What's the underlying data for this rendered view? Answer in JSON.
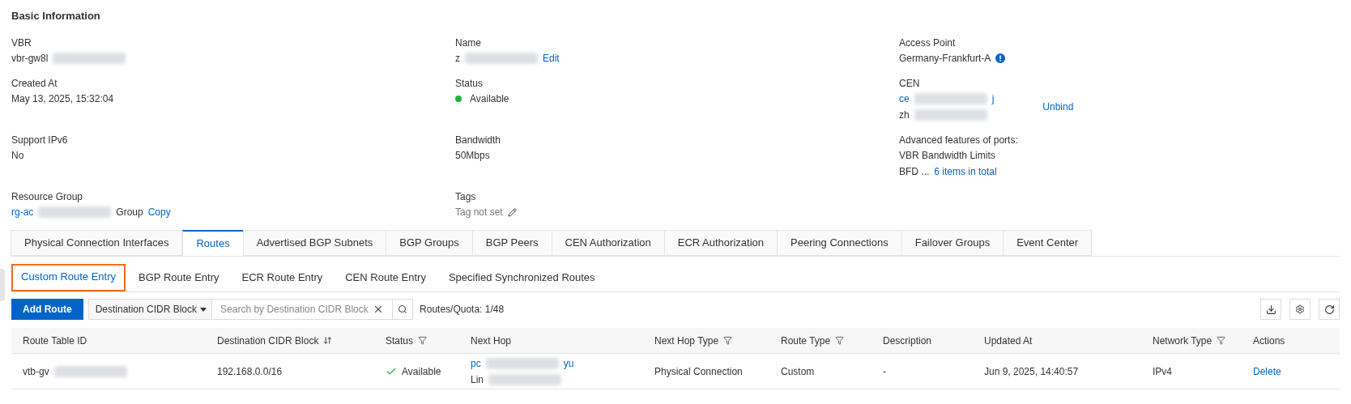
{
  "section_title": "Basic Information",
  "fields": [
    {
      "label": "VBR",
      "lines": [
        [
          {
            "kind": "text",
            "text": "vbr-gw8l"
          },
          {
            "kind": "redacted"
          }
        ]
      ]
    },
    {
      "label": "Name",
      "lines": [
        [
          {
            "kind": "text",
            "text": "z"
          },
          {
            "kind": "redacted"
          },
          {
            "kind": "link",
            "text": "Edit"
          }
        ]
      ]
    },
    {
      "label": "Access Point",
      "lines": [
        [
          {
            "kind": "text",
            "text": "Germany-Frankfurt-A"
          },
          {
            "kind": "info"
          }
        ]
      ]
    },
    {
      "label": "Created At",
      "lines": [
        [
          {
            "kind": "text",
            "text": "May 13, 2025, 15:32:04"
          }
        ]
      ]
    },
    {
      "label": "Status",
      "lines": [
        [
          {
            "kind": "dot",
            "color": "#1db33e"
          },
          {
            "kind": "text",
            "text": "Available"
          }
        ]
      ]
    },
    {
      "label": "CEN",
      "side_link": "Unbind",
      "lines": [
        [
          {
            "kind": "link",
            "text": "ce"
          },
          {
            "kind": "redacted"
          },
          {
            "kind": "link",
            "text": "j"
          }
        ],
        [
          {
            "kind": "text",
            "text": "zh"
          },
          {
            "kind": "redacted"
          }
        ]
      ]
    },
    {
      "label": "Support IPv6",
      "lines": [
        [
          {
            "kind": "text",
            "text": "No"
          }
        ]
      ]
    },
    {
      "label": "Bandwidth",
      "lines": [
        [
          {
            "kind": "text",
            "text": "50Mbps"
          }
        ]
      ]
    },
    {
      "label": "Advanced features of ports:",
      "lines": [
        [
          {
            "kind": "text",
            "text": "VBR Bandwidth Limits"
          }
        ],
        [
          {
            "kind": "text",
            "text": "BFD ..."
          },
          {
            "kind": "link",
            "text": "6 items in total"
          }
        ]
      ]
    },
    {
      "label": "Resource Group",
      "lines": [
        [
          {
            "kind": "link",
            "text": "rg-ac"
          },
          {
            "kind": "redacted"
          },
          {
            "kind": "text",
            "text": "Group"
          },
          {
            "kind": "link",
            "text": "Copy"
          }
        ]
      ]
    },
    {
      "label": "Tags",
      "lines": [
        [
          {
            "kind": "muted",
            "text": "Tag not set"
          },
          {
            "kind": "pencil"
          }
        ]
      ]
    }
  ],
  "tabs": [
    {
      "label": "Physical Connection Interfaces",
      "selected": false
    },
    {
      "label": "Routes",
      "selected": true
    },
    {
      "label": "Advertised BGP Subnets",
      "selected": false
    },
    {
      "label": "BGP Groups",
      "selected": false
    },
    {
      "label": "BGP Peers",
      "selected": false
    },
    {
      "label": "CEN Authorization",
      "selected": false
    },
    {
      "label": "ECR Authorization",
      "selected": false
    },
    {
      "label": "Peering Connections",
      "selected": false
    },
    {
      "label": "Failover Groups",
      "selected": false
    },
    {
      "label": "Event Center",
      "selected": false
    }
  ],
  "subtabs": [
    {
      "label": "Custom Route Entry",
      "selected": true,
      "highlighted": true
    },
    {
      "label": "BGP Route Entry",
      "selected": false,
      "highlighted": false
    },
    {
      "label": "ECR Route Entry",
      "selected": false,
      "highlighted": false
    },
    {
      "label": "CEN Route Entry",
      "selected": false,
      "highlighted": false
    },
    {
      "label": "Specified Synchronized Routes",
      "selected": false,
      "highlighted": false
    }
  ],
  "toolbar": {
    "add_button": "Add Route",
    "filter_select": "Destination CIDR Block",
    "search": {
      "placeholder": "Search by Destination CIDR Block"
    },
    "quota": "Routes/Quota: 1/48"
  },
  "table": {
    "columns": [
      {
        "label": "Route Table ID",
        "kind": "plain"
      },
      {
        "label": "Destination CIDR Block",
        "kind": "sortable"
      },
      {
        "label": "Status",
        "kind": "filterable"
      },
      {
        "label": "Next Hop",
        "kind": "plain"
      },
      {
        "label": "Next Hop Type",
        "kind": "filterable"
      },
      {
        "label": "Route Type",
        "kind": "filterable"
      },
      {
        "label": "Description",
        "kind": "plain"
      },
      {
        "label": "Updated At",
        "kind": "plain"
      },
      {
        "label": "Network Type",
        "kind": "filterable"
      },
      {
        "label": "Actions",
        "kind": "plain"
      }
    ],
    "rows": [
      [
        {
          "lines": [
            [
              {
                "kind": "text",
                "text": "vtb-gv"
              },
              {
                "kind": "redacted"
              }
            ]
          ]
        },
        {
          "lines": [
            [
              {
                "kind": "text",
                "text": "192.168.0.0/16"
              }
            ]
          ]
        },
        {
          "lines": [
            [
              {
                "kind": "check"
              },
              {
                "kind": "text",
                "text": "Available"
              }
            ]
          ]
        },
        {
          "lines": [
            [
              {
                "kind": "link",
                "text": "pc"
              },
              {
                "kind": "redacted"
              },
              {
                "kind": "link",
                "text": "yu"
              }
            ],
            [
              {
                "kind": "text",
                "text": "Lin"
              },
              {
                "kind": "redacted"
              }
            ]
          ]
        },
        {
          "lines": [
            [
              {
                "kind": "text",
                "text": "Physical Connection"
              }
            ]
          ]
        },
        {
          "lines": [
            [
              {
                "kind": "text",
                "text": "Custom"
              }
            ]
          ]
        },
        {
          "lines": [
            [
              {
                "kind": "text",
                "text": "-"
              }
            ]
          ]
        },
        {
          "lines": [
            [
              {
                "kind": "text",
                "text": "Jun 9, 2025, 14:40:57"
              }
            ]
          ]
        },
        {
          "lines": [
            [
              {
                "kind": "text",
                "text": "IPv4"
              }
            ]
          ]
        },
        {
          "lines": [
            [
              {
                "kind": "link",
                "text": "Delete"
              }
            ]
          ]
        }
      ]
    ]
  }
}
